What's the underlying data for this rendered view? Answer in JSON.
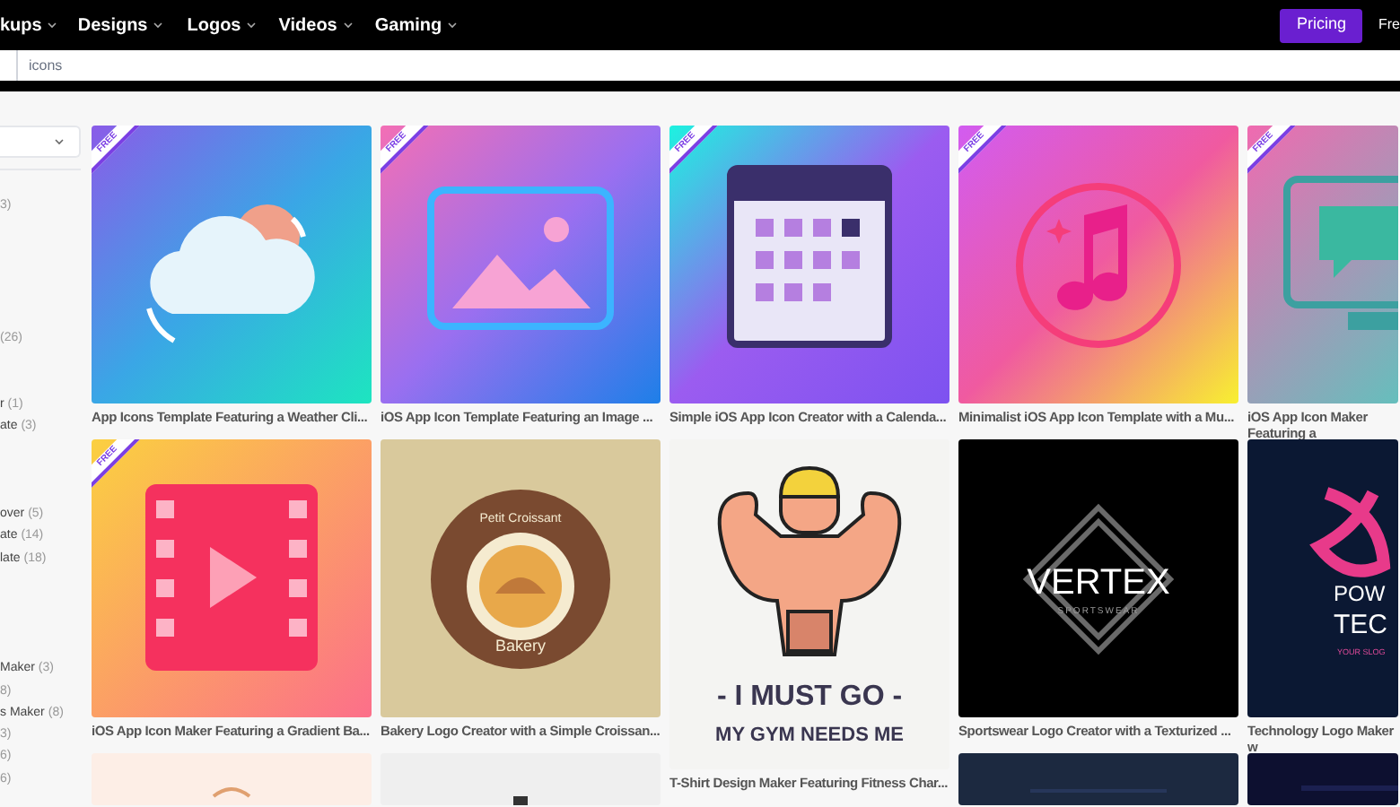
{
  "nav": {
    "items": [
      {
        "label": "kups"
      },
      {
        "label": "Designs"
      },
      {
        "label": "Logos"
      },
      {
        "label": "Videos"
      },
      {
        "label": "Gaming"
      }
    ],
    "pricing_button": "Pricing",
    "cut_link": "Fre"
  },
  "search": {
    "value": "icons"
  },
  "sidebar": {
    "items": [
      {
        "count": "3)"
      },
      {
        "count": "(26)"
      },
      {
        "label": "r",
        "count": "(1)"
      },
      {
        "label": "ate",
        "count": "(3)"
      },
      {
        "label": "over",
        "count": "(5)"
      },
      {
        "label": "ate",
        "count": "(14)"
      },
      {
        "label": "late",
        "count": "(18)"
      },
      {
        "label": "Maker",
        "count": "(3)"
      },
      {
        "count": "8)"
      },
      {
        "label": "s Maker",
        "count": "(8)"
      },
      {
        "count": "3)"
      },
      {
        "count": "6)"
      },
      {
        "count": "6)"
      }
    ]
  },
  "columns": [
    {
      "cards": [
        {
          "kind": "weather",
          "badge": "FREE",
          "caption": "App Icons Template Featuring a Weather Cli..."
        },
        {
          "kind": "film",
          "badge": "FREE",
          "caption": "iOS App Icon Maker Featuring a Gradient Ba..."
        },
        {
          "kind": "peach"
        }
      ]
    },
    {
      "cards": [
        {
          "kind": "image",
          "badge": "FREE",
          "caption": "iOS App Icon Template Featuring an Image ..."
        },
        {
          "kind": "bakery",
          "art_text": [
            "Petit Croissant",
            "Bakery"
          ],
          "caption": "Bakery Logo Creator with a Simple Croissan..."
        },
        {
          "kind": "gray"
        }
      ]
    },
    {
      "cards": [
        {
          "kind": "calendar",
          "badge": "FREE",
          "caption": "Simple iOS App Icon Creator with a Calenda..."
        },
        {
          "kind": "gym",
          "art_text": [
            "- I MUST GO -",
            "MY GYM NEEDS ME"
          ],
          "caption": "T-Shirt Design Maker Featuring Fitness Char..."
        }
      ]
    },
    {
      "cards": [
        {
          "kind": "music",
          "badge": "FREE",
          "caption": "Minimalist iOS App Icon Template with a Mu..."
        },
        {
          "kind": "vertex",
          "art_text": [
            "VERTEX",
            "SPORTSWEAR"
          ],
          "caption": "Sportswear Logo Creator with a Texturized ..."
        },
        {
          "kind": "navy"
        }
      ]
    },
    {
      "cards": [
        {
          "kind": "chat",
          "badge": "FREE",
          "caption": "iOS App Icon Maker Featuring a"
        },
        {
          "kind": "tech",
          "art_text": [
            "POW",
            "TEC",
            "YOUR SLOG"
          ],
          "caption": "Technology Logo Maker w"
        },
        {
          "kind": "dark"
        }
      ]
    }
  ]
}
